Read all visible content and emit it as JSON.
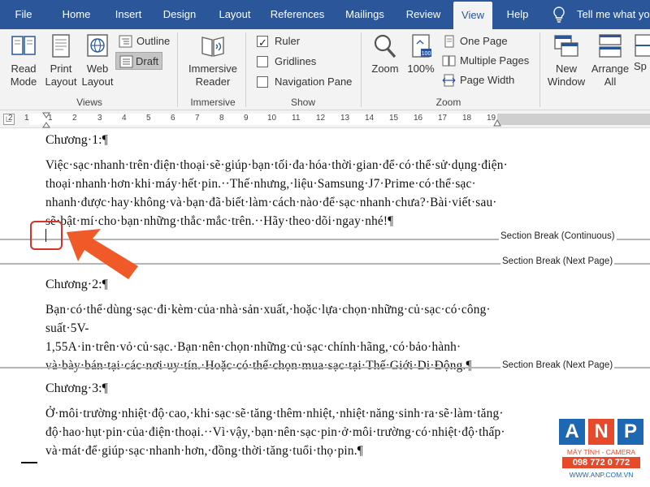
{
  "ribbon_tabs": [
    "File",
    "Home",
    "Insert",
    "Design",
    "Layout",
    "References",
    "Mailings",
    "Review",
    "View",
    "Help"
  ],
  "active_tab": "View",
  "tell_me": "Tell me what yo",
  "views_group": {
    "label": "Views",
    "read_mode": "Read Mode",
    "read_mode_l1": "Read",
    "read_mode_l2": "Mode",
    "print_layout_l1": "Print",
    "print_layout_l2": "Layout",
    "web_layout_l1": "Web",
    "web_layout_l2": "Layout",
    "outline": "Outline",
    "draft": "Draft"
  },
  "immersive_group": {
    "label": "Immersive",
    "reader_l1": "Immersive",
    "reader_l2": "Reader"
  },
  "show_group": {
    "label": "Show",
    "ruler": "Ruler",
    "ruler_checked": true,
    "gridlines": "Gridlines",
    "gridlines_checked": false,
    "navigation_pane": "Navigation Pane",
    "navigation_pane_checked": false
  },
  "zoom_group": {
    "label": "Zoom",
    "zoom": "Zoom",
    "hundred": "100%",
    "one_page": "One Page",
    "multiple_pages": "Multiple Pages",
    "page_width": "Page Width"
  },
  "window_group": {
    "new_window_l1": "New",
    "new_window_l2": "Window",
    "arrange_all_l1": "Arrange",
    "arrange_all_l2": "All",
    "split_partial": "Sp"
  },
  "ruler_ticks": [
    "1",
    "2",
    "1",
    "2",
    "3",
    "4",
    "5",
    "6",
    "7",
    "8",
    "9",
    "10",
    "11",
    "12",
    "13",
    "14",
    "15",
    "16",
    "17",
    "18",
    "19"
  ],
  "document": {
    "ch1_title": "Chương·1:¶",
    "ch1_lines": [
      "Việc·sạc·nhanh·trên·điện·thoại·sẽ·giúp·bạn·tối·đa·hóa·thời·gian·để·có·thể·sử·dụng·điện·",
      "thoại·nhanh·hơn·khi·máy·hết·pin.··Thế·nhưng,·liệu·Samsung·J7·Prime·có·thể·sạc·",
      "nhanh·được·hay·không·và·bạn·đã·biết·làm·cách·nào·để·sạc·nhanh·chưa?·Bài·viết·sau·",
      "sẽ·bật·mí·cho·bạn·những·thắc·mắc·trên.··Hãy·theo·dõi·ngay·nhé!¶"
    ],
    "break1": "Section Break (Continuous)",
    "break2": "Section Break (Next Page)",
    "ch2_title": "Chương·2:¶",
    "ch2_lines": [
      "Bạn·có·thể·dùng·sạc·đi·kèm·của·nhà·sản·xuất,·hoặc·lựa·chọn·những·củ·sạc·có·công·",
      "suất·5V-1,55A·in·trên·vỏ·củ·sạc.·Bạn·nên·chọn·những·củ·sạc·chính·hãng,·có·bảo·hành·",
      "và·bày·bán·tại·các·nơi·uy·tín.·Hoặc·có·thể·chọn·mua·sạc·tại·Thế·Giới·Di·Động.¶"
    ],
    "break3": "Section Break (Next Page)",
    "ch3_title": "Chương·3:¶",
    "ch3_lines": [
      "Ở·môi·trường·nhiệt·độ·cao,·khi·sạc·sẽ·tăng·thêm·nhiệt,·nhiệt·năng·sinh·ra·sẽ·làm·tăng·",
      "độ·hao·hụt·pin·của·điện·thoại.··Vì·vậy,·bạn·nên·sạc·pin·ở·môi·trường·có·nhiệt·độ·thấp·",
      "và·mát·để·giúp·sạc·nhanh·hơn,·đồng·thời·tăng·tuổi·thọ·pin.¶"
    ]
  },
  "watermark": {
    "letters": [
      "A",
      "N",
      "P"
    ],
    "subtitle": "MÁY TÍNH - CAMERA",
    "phone": "098 772 0 772",
    "website": "WWW.ANP.COM.VN"
  },
  "colors": {
    "tab_bar": "#2b579a",
    "ribbon": "#f3f3f3",
    "annotation_red": "#d4332a",
    "arrow_orange": "#f05a28",
    "logo_blue": "#1e67b3",
    "logo_red": "#e74a2b"
  }
}
